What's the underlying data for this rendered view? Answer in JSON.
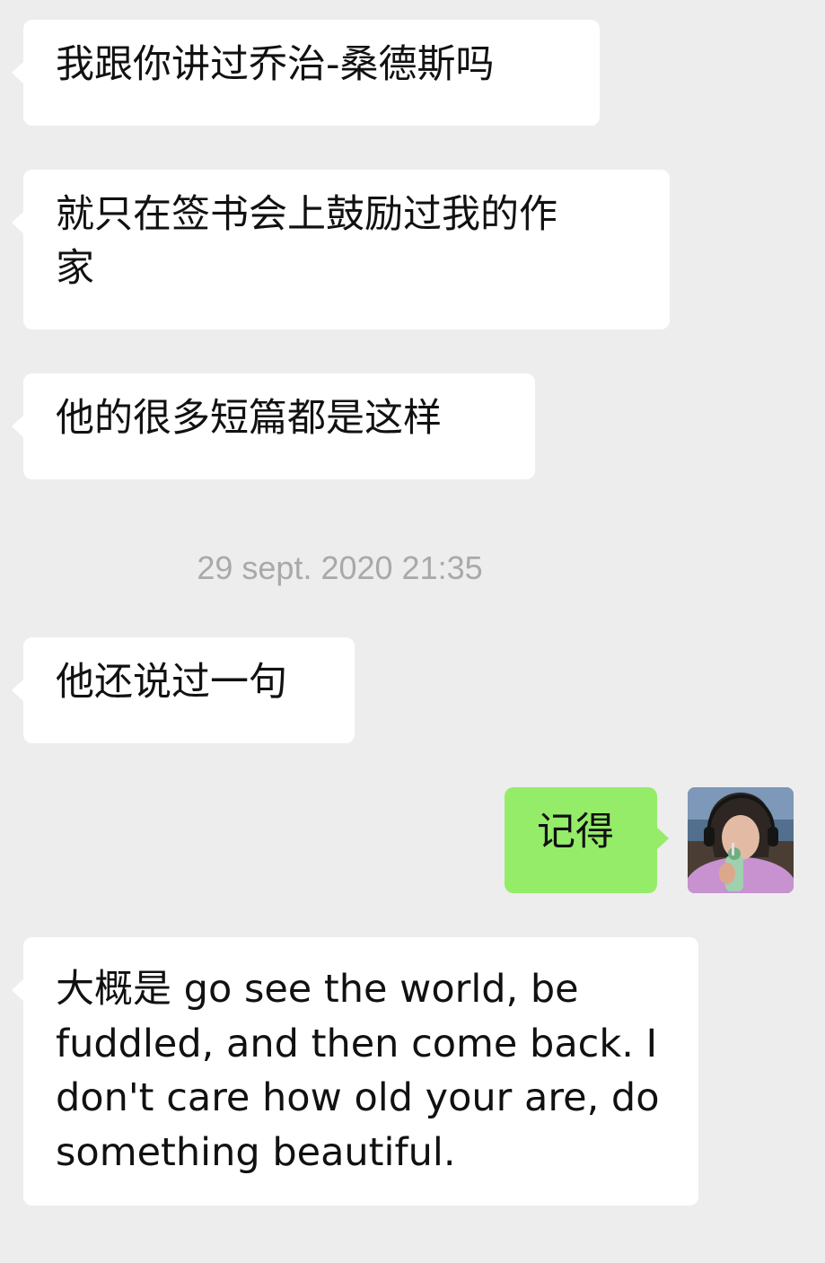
{
  "conversation": {
    "messages": [
      {
        "direction": "incoming",
        "text": "我跟你讲过乔治-桑德斯吗"
      },
      {
        "direction": "incoming",
        "text": "就只在签书会上鼓励过我的作\n家"
      },
      {
        "direction": "incoming",
        "text": "他的很多短篇都是这样"
      },
      {
        "direction": "incoming",
        "text": "他还说过一句"
      },
      {
        "direction": "outgoing",
        "text": "记得"
      },
      {
        "direction": "incoming",
        "text": "大概是 go see the world, be\nfuddled, and then come back. I\ndon't care how old your are, do\nsomething beautiful."
      }
    ],
    "timestamp": "29 sept. 2020 21:35"
  },
  "icons": {
    "avatar": "user-avatar-photo"
  },
  "colors": {
    "background": "#ededed",
    "incoming_bubble": "#ffffff",
    "outgoing_bubble": "#95ec69",
    "timestamp_text": "#a9a9a9"
  }
}
